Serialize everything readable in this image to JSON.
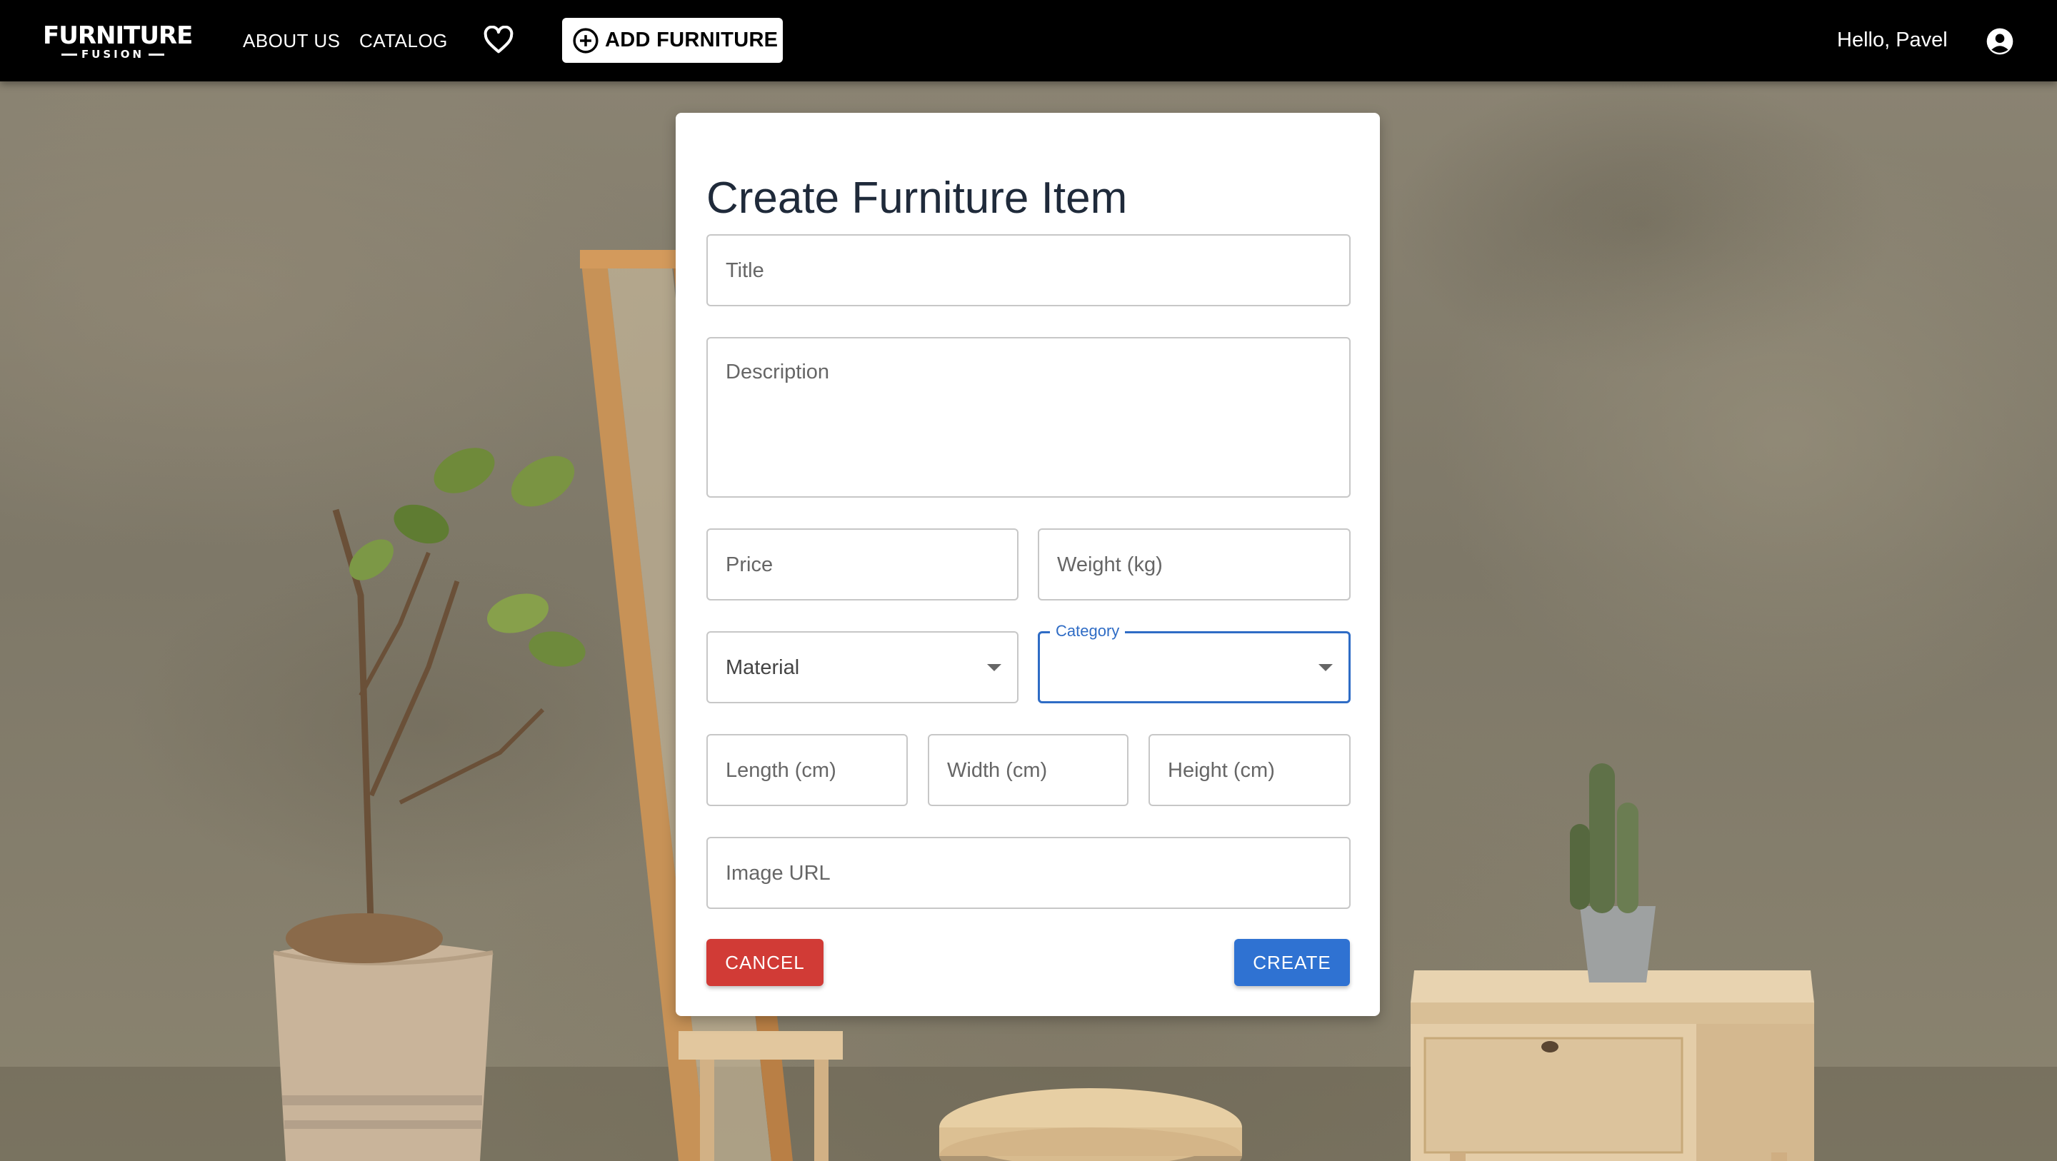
{
  "brand": {
    "name": "FURNITURE",
    "sub": "FUSION"
  },
  "nav": {
    "about": "ABOUT US",
    "catalog": "CATALOG",
    "add_button": "ADD FURNITURE",
    "greeting": "Hello, Pavel",
    "icons": [
      "heart-icon",
      "plus-circle-icon",
      "account-circle-icon"
    ]
  },
  "form": {
    "title": "Create Furniture Item",
    "fields": {
      "title": "Title",
      "description": "Description",
      "price": "Price",
      "weight": "Weight (kg)",
      "material": "Material",
      "category": "Category",
      "length": "Length (cm)",
      "width": "Width (cm)",
      "height": "Height (cm)",
      "image_url": "Image URL"
    },
    "buttons": {
      "cancel": "CANCEL",
      "create": "CREATE"
    }
  },
  "colors": {
    "navbar": "#000000",
    "focus": "#2f6cc5",
    "cancel": "#d13b36",
    "create": "#2f72d2"
  }
}
